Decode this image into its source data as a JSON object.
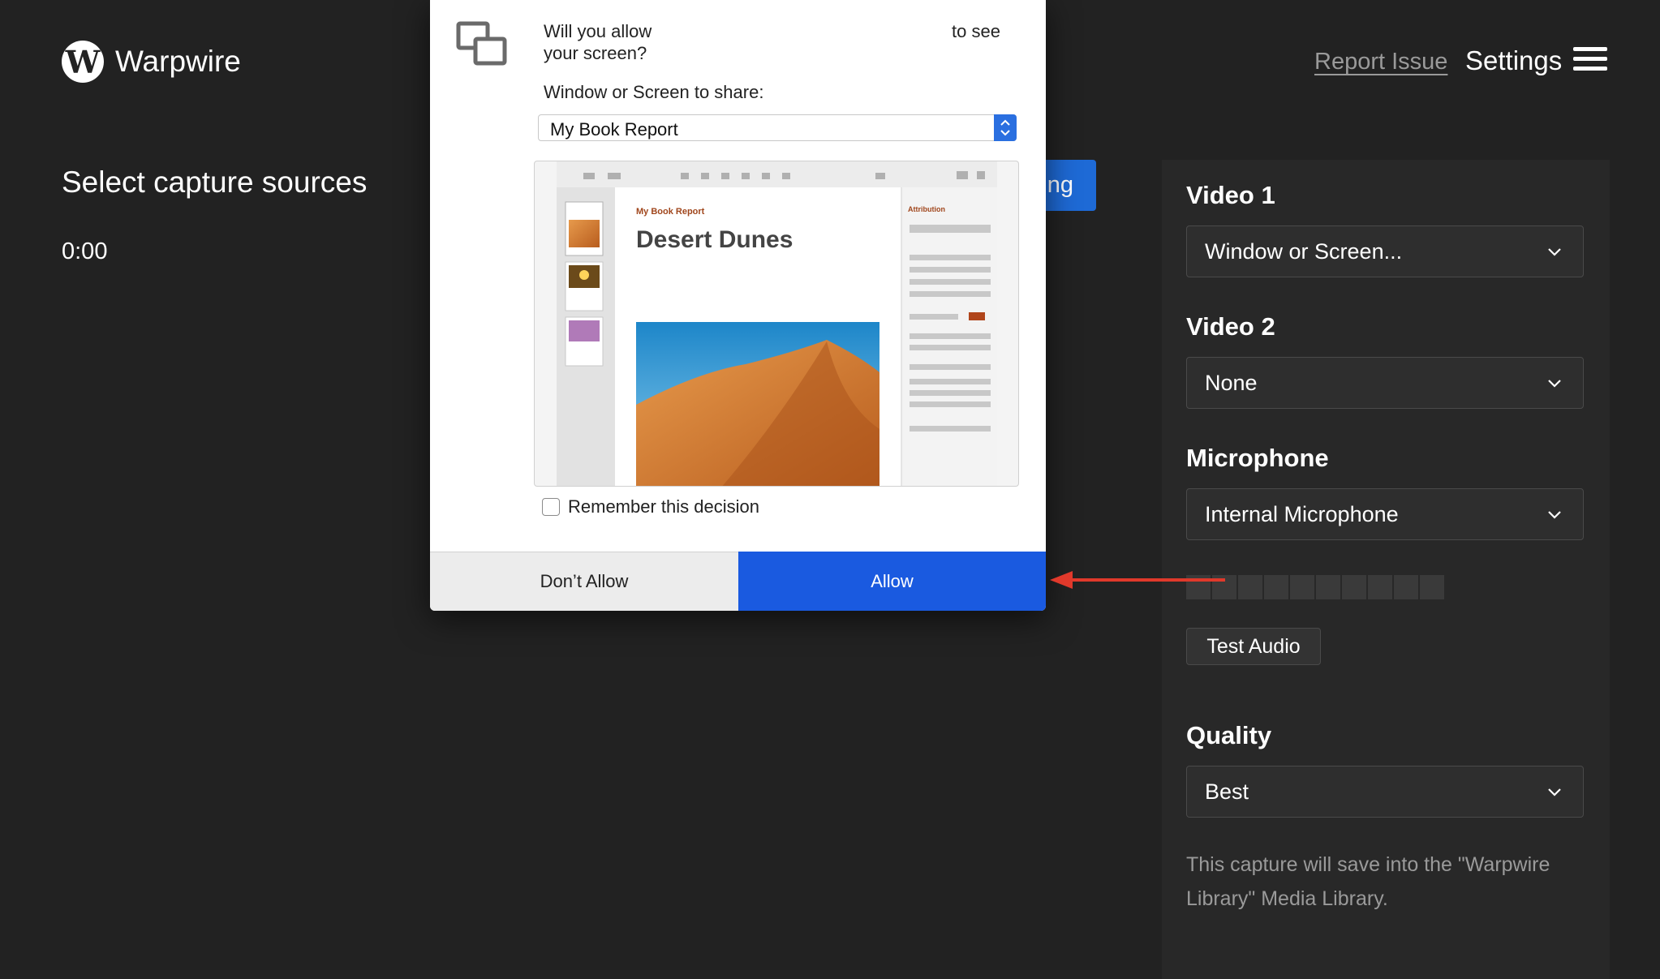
{
  "header": {
    "logo_letter": "W",
    "logo_text": "Warpwire",
    "report_issue": "Report Issue",
    "settings": "Settings"
  },
  "main": {
    "title": "Select capture sources",
    "timer": "0:00",
    "start_button_partial": "ng"
  },
  "panel": {
    "video1": {
      "label": "Video 1",
      "value": "Window or Screen..."
    },
    "video2": {
      "label": "Video 2",
      "value": "None"
    },
    "microphone": {
      "label": "Microphone",
      "value": "Internal Microphone"
    },
    "test_audio": "Test Audio",
    "quality": {
      "label": "Quality",
      "value": "Best"
    },
    "save_note": "This capture will save into the \"Warpwire Library\" Media Library."
  },
  "dialog": {
    "question_line1": "Will you allow",
    "question_line2": "your screen?",
    "to_see": "to see",
    "share_label": "Window or Screen to share:",
    "share_value": "My Book Report",
    "preview": {
      "doc_header": "My Book Report",
      "doc_title": "Desert Dunes",
      "sidebar_title": "Attribution"
    },
    "remember": "Remember this decision",
    "dont_allow": "Don’t Allow",
    "allow": "Allow"
  },
  "colors": {
    "background": "#222222",
    "accent_blue": "#1a5ae0",
    "arrow_red": "#e0392b"
  }
}
